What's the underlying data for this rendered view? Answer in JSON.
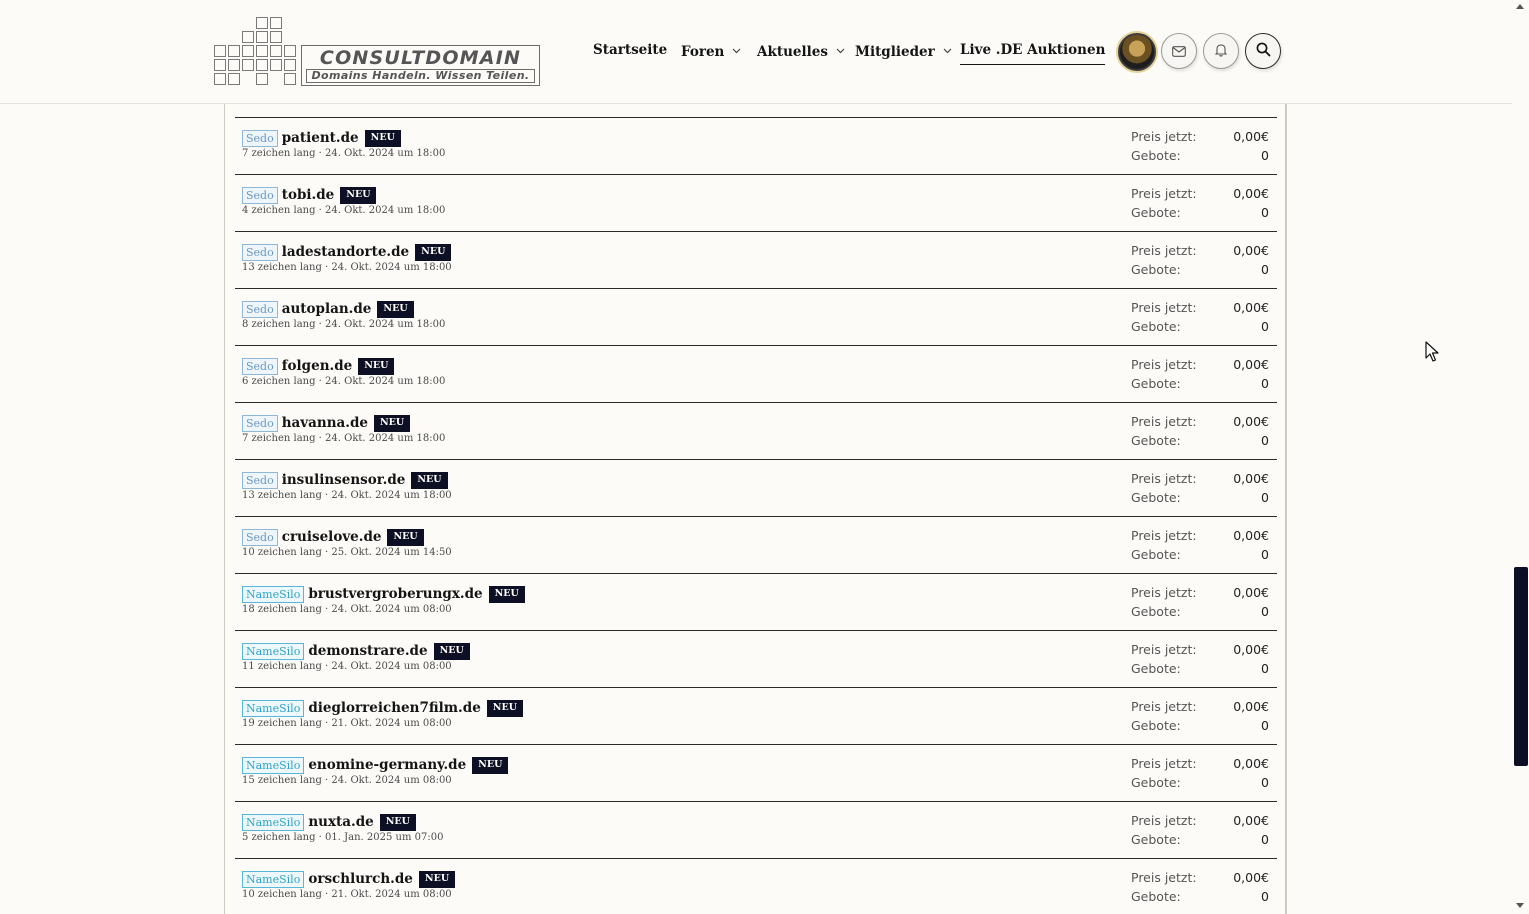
{
  "logo": {
    "title": "CONSULTDOMAIN",
    "subtitle": "Domains Handeln. Wissen Teilen."
  },
  "nav": {
    "items": [
      {
        "label": "Startseite",
        "has_dropdown": false
      },
      {
        "label": "Foren",
        "has_dropdown": true
      },
      {
        "label": "Aktuelles",
        "has_dropdown": true
      },
      {
        "label": "Mitglieder",
        "has_dropdown": true
      },
      {
        "label": "Live .DE Auktionen",
        "has_dropdown": false,
        "active": true
      }
    ]
  },
  "header_icons": [
    "avatar",
    "envelope-icon",
    "bell-icon",
    "search-icon"
  ],
  "labels": {
    "price": "Preis jetzt:",
    "bids": "Gebote:",
    "new_badge": "NEU"
  },
  "listings": [
    {
      "source": "Sedo",
      "domain": "patient.de",
      "meta": "7 zeichen lang · 24. Okt. 2024 um 18:00",
      "price": "0,00€",
      "bids": "0"
    },
    {
      "source": "Sedo",
      "domain": "tobi.de",
      "meta": "4 zeichen lang · 24. Okt. 2024 um 18:00",
      "price": "0,00€",
      "bids": "0"
    },
    {
      "source": "Sedo",
      "domain": "ladestandorte.de",
      "meta": "13 zeichen lang · 24. Okt. 2024 um 18:00",
      "price": "0,00€",
      "bids": "0"
    },
    {
      "source": "Sedo",
      "domain": "autoplan.de",
      "meta": "8 zeichen lang · 24. Okt. 2024 um 18:00",
      "price": "0,00€",
      "bids": "0"
    },
    {
      "source": "Sedo",
      "domain": "folgen.de",
      "meta": "6 zeichen lang · 24. Okt. 2024 um 18:00",
      "price": "0,00€",
      "bids": "0"
    },
    {
      "source": "Sedo",
      "domain": "havanna.de",
      "meta": "7 zeichen lang · 24. Okt. 2024 um 18:00",
      "price": "0,00€",
      "bids": "0"
    },
    {
      "source": "Sedo",
      "domain": "insulinsensor.de",
      "meta": "13 zeichen lang · 24. Okt. 2024 um 18:00",
      "price": "0,00€",
      "bids": "0"
    },
    {
      "source": "Sedo",
      "domain": "cruiselove.de",
      "meta": "10 zeichen lang · 25. Okt. 2024 um 14:50",
      "price": "0,00€",
      "bids": "0"
    },
    {
      "source": "NameSilo",
      "domain": "brustvergroberungx.de",
      "meta": "18 zeichen lang · 24. Okt. 2024 um 08:00",
      "price": "0,00€",
      "bids": "0"
    },
    {
      "source": "NameSilo",
      "domain": "demonstrare.de",
      "meta": "11 zeichen lang · 24. Okt. 2024 um 08:00",
      "price": "0,00€",
      "bids": "0"
    },
    {
      "source": "NameSilo",
      "domain": "dieglorreichen7film.de",
      "meta": "19 zeichen lang · 21. Okt. 2024 um 08:00",
      "price": "0,00€",
      "bids": "0"
    },
    {
      "source": "NameSilo",
      "domain": "enomine-germany.de",
      "meta": "15 zeichen lang · 24. Okt. 2024 um 08:00",
      "price": "0,00€",
      "bids": "0"
    },
    {
      "source": "NameSilo",
      "domain": "nuxta.de",
      "meta": "5 zeichen lang · 01. Jan. 2025 um 07:00",
      "price": "0,00€",
      "bids": "0"
    },
    {
      "source": "NameSilo",
      "domain": "orschlurch.de",
      "meta": "10 zeichen lang · 21. Okt. 2024 um 08:00",
      "price": "0,00€",
      "bids": "0"
    }
  ],
  "colors": {
    "background": "#fcfbf8",
    "badge_bg": "#0d1024",
    "sedo_tag": "#6a98c4",
    "namesilo_tag": "#2ea3cc"
  }
}
